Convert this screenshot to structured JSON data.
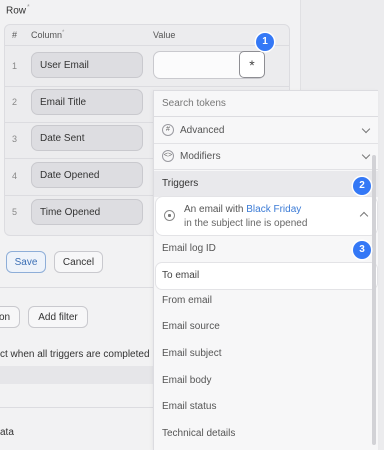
{
  "section_label": "Row",
  "required_mark": "*",
  "table": {
    "headers": {
      "num": "#",
      "column": "Column",
      "value": "Value"
    },
    "rows": [
      {
        "num": "1",
        "column": "User Email"
      },
      {
        "num": "2",
        "column": "Email Title"
      },
      {
        "num": "3",
        "column": "Date Sent"
      },
      {
        "num": "4",
        "column": "Date Opened"
      },
      {
        "num": "5",
        "column": "Time Opened"
      }
    ],
    "token_button": "*"
  },
  "actions": {
    "save": "Save",
    "cancel": "Cancel"
  },
  "filters": {
    "partial_button": "on",
    "add_filter": "Add filter"
  },
  "note_text": "ct when all triggers are completed",
  "bottom_label": "ata",
  "dropdown": {
    "search_placeholder": "Search tokens",
    "categories": [
      {
        "label": "Advanced",
        "icon": "hash-icon",
        "glyph": "#"
      },
      {
        "label": "Modifiers",
        "icon": "code-icon",
        "glyph": "<>"
      }
    ],
    "triggers_heading": "Triggers",
    "trigger": {
      "prefix": "An email with ",
      "highlight": "Black Friday",
      "line2": "in the subject line is opened"
    },
    "items": [
      "Email log ID",
      "To email",
      "From email",
      "Email source",
      "Email subject",
      "Email body",
      "Email status",
      "Technical details"
    ],
    "selected_index": 1
  },
  "badges": [
    "1",
    "2",
    "3"
  ],
  "colors": {
    "accent": "#3478f6",
    "highlight_text": "#3b7bd6"
  }
}
